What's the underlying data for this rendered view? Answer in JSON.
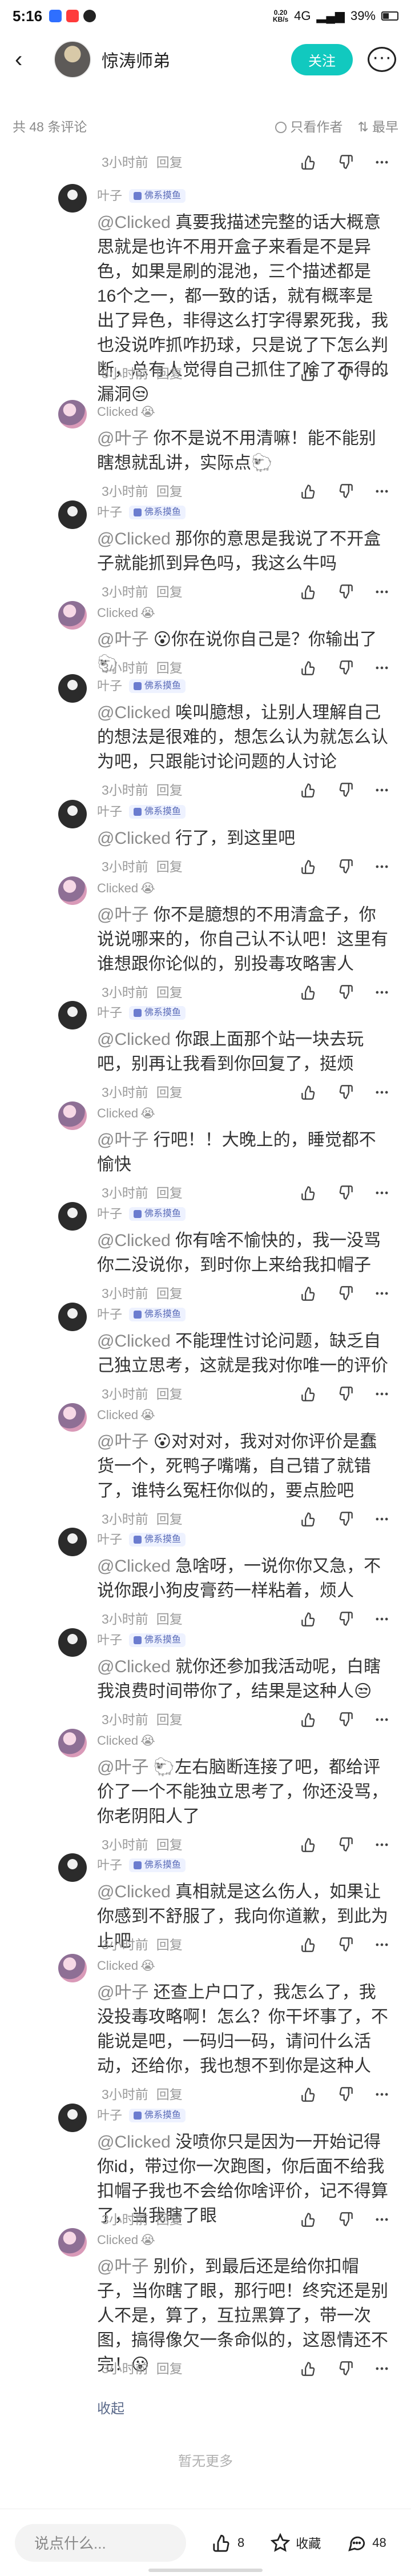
{
  "status": {
    "time": "5:16",
    "net_top": "0.20",
    "net_bottom": "KB/s",
    "signal": "4G",
    "battery": "39%"
  },
  "topnav": {
    "back": "‹",
    "name": "惊涛师弟",
    "follow": "关注"
  },
  "subhead": {
    "count": "共 48 条评论",
    "only_author": "只看作者",
    "sort": "最早"
  },
  "top_meta": {
    "time": "3小时前",
    "reply": "回复"
  },
  "comments": [
    {
      "user": "叶子",
      "tag": "佛系摸鱼",
      "emoji": "",
      "avatar": "a",
      "mention": "@Clicked",
      "text": " 真要我描述完整的话大概意思就是也许不用开盒子来看是不是异色，如果是刷的混池，三个描述都是16个之一，都一致的话，就有概率是出了异色，非得这么打字得累死我，我也没说咋抓咋扔球，只是说了下怎么判断，总有人觉得自己抓住了啥了不得的漏洞😒",
      "time": "3小时前",
      "reply": "回复"
    },
    {
      "user": "Clicked",
      "tag": "",
      "emoji": "😭",
      "avatar": "b",
      "mention": "@叶子",
      "text": " 你不是说不用清嘛！能不能别瞎想就乱讲，实际点🐑",
      "time": "3小时前",
      "reply": "回复"
    },
    {
      "user": "叶子",
      "tag": "佛系摸鱼",
      "emoji": "",
      "avatar": "a",
      "mention": "@Clicked",
      "text": " 那你的意思是我说了不开盒子就能抓到异色吗，我这么牛吗",
      "time": "3小时前",
      "reply": "回复"
    },
    {
      "user": "Clicked",
      "tag": "",
      "emoji": "😭",
      "avatar": "b",
      "mention": "@叶子",
      "text": " 😮你在说你自己是？你输出了🐑",
      "time": "3小时前",
      "reply": "回复"
    },
    {
      "user": "叶子",
      "tag": "佛系摸鱼",
      "emoji": "",
      "avatar": "a",
      "mention": "@Clicked",
      "text": " 唉叫臆想，让别人理解自己的想法是很难的，想怎么认为就怎么认为吧，只跟能讨论问题的人讨论",
      "time": "3小时前",
      "reply": "回复"
    },
    {
      "user": "叶子",
      "tag": "佛系摸鱼",
      "emoji": "",
      "avatar": "a",
      "mention": "@Clicked",
      "text": " 行了，到这里吧",
      "time": "3小时前",
      "reply": "回复"
    },
    {
      "user": "Clicked",
      "tag": "",
      "emoji": "😭",
      "avatar": "b",
      "mention": "@叶子",
      "text": " 你不是臆想的不用清盒子，你说说哪来的，你自己认不认吧！这里有谁想跟你论似的，别投毒攻略害人",
      "time": "3小时前",
      "reply": "回复"
    },
    {
      "user": "叶子",
      "tag": "佛系摸鱼",
      "emoji": "",
      "avatar": "a",
      "mention": "@Clicked",
      "text": " 你跟上面那个站一块去玩吧，别再让我看到你回复了，挺烦",
      "time": "3小时前",
      "reply": "回复"
    },
    {
      "user": "Clicked",
      "tag": "",
      "emoji": "😭",
      "avatar": "b",
      "mention": "@叶子",
      "text": " 行吧！！大晚上的，睡觉都不愉快",
      "time": "3小时前",
      "reply": "回复"
    },
    {
      "user": "叶子",
      "tag": "佛系摸鱼",
      "emoji": "",
      "avatar": "a",
      "mention": "@Clicked",
      "text": " 你有啥不愉快的，我一没骂你二没说你，到时你上来给我扣帽子",
      "time": "3小时前",
      "reply": "回复"
    },
    {
      "user": "叶子",
      "tag": "佛系摸鱼",
      "emoji": "",
      "avatar": "a",
      "mention": "@Clicked",
      "text": " 不能理性讨论问题，缺乏自己独立思考，这就是我对你唯一的评价",
      "time": "3小时前",
      "reply": "回复"
    },
    {
      "user": "Clicked",
      "tag": "",
      "emoji": "😭",
      "avatar": "b",
      "mention": "@叶子",
      "text": " 😮对对对，我对对你评价是蠢货一个，死鸭子嘴嘴，自己错了就错了，谁特么冤枉你似的，要点脸吧",
      "time": "3小时前",
      "reply": "回复"
    },
    {
      "user": "叶子",
      "tag": "佛系摸鱼",
      "emoji": "",
      "avatar": "a",
      "mention": "@Clicked",
      "text": " 急啥呀，一说你你又急，不说你跟小狗皮膏药一样粘着，烦人",
      "time": "3小时前",
      "reply": "回复"
    },
    {
      "user": "叶子",
      "tag": "佛系摸鱼",
      "emoji": "",
      "avatar": "a",
      "mention": "@Clicked",
      "text": " 就你还参加我活动呢，白瞎我浪费时间带你了，结果是这种人😒",
      "time": "3小时前",
      "reply": "回复"
    },
    {
      "user": "Clicked",
      "tag": "",
      "emoji": "😭",
      "avatar": "b",
      "mention": "@叶子",
      "text": " 🐑左右脑断连接了吧，都给评价了一个不能独立思考了，你还没骂，你老阴阳人了",
      "time": "3小时前",
      "reply": "回复"
    },
    {
      "user": "叶子",
      "tag": "佛系摸鱼",
      "emoji": "",
      "avatar": "a",
      "mention": "@Clicked",
      "text": " 真相就是这么伤人，如果让你感到不舒服了，我向你道歉，到此为止吧",
      "time": "3小时前",
      "reply": "回复"
    },
    {
      "user": "Clicked",
      "tag": "",
      "emoji": "😭",
      "avatar": "b",
      "mention": "@叶子",
      "text": " 还查上户口了，我怎么了，我没投毒攻略啊！怎么？你干坏事了，不能说是吧，一码归一码，请问什么活动，还给你，我也想不到你是这种人",
      "time": "3小时前",
      "reply": "回复"
    },
    {
      "user": "叶子",
      "tag": "佛系摸鱼",
      "emoji": "",
      "avatar": "a",
      "mention": "@Clicked",
      "text": " 没喷你只是因为一开始记得你id，带过你一次跑图，你后面不给我扣帽子我也不会给你啥评价，记不得算了，当我瞎了眼",
      "time": "3小时前",
      "reply": "回复"
    },
    {
      "user": "Clicked",
      "tag": "",
      "emoji": "😭",
      "avatar": "b",
      "mention": "@叶子",
      "text": " 别价，到最后还是给你扣帽子，当你瞎了眼，那行吧！终究还是别人不是，算了，互拉黑算了，带一次图，搞得像欠一条命似的，这恩情还不完！😮",
      "time": "3小时前",
      "reply": "回复"
    }
  ],
  "collapse": "收起",
  "no_more": "暂无更多",
  "bottombar": {
    "input_placeholder": "说点什么...",
    "likes": "8",
    "fav": "收藏",
    "comments": "48"
  },
  "colors": {
    "accent": "#11c9bf",
    "tag_bg": "#eef2ff",
    "tag_text": "#5b6cb8"
  }
}
